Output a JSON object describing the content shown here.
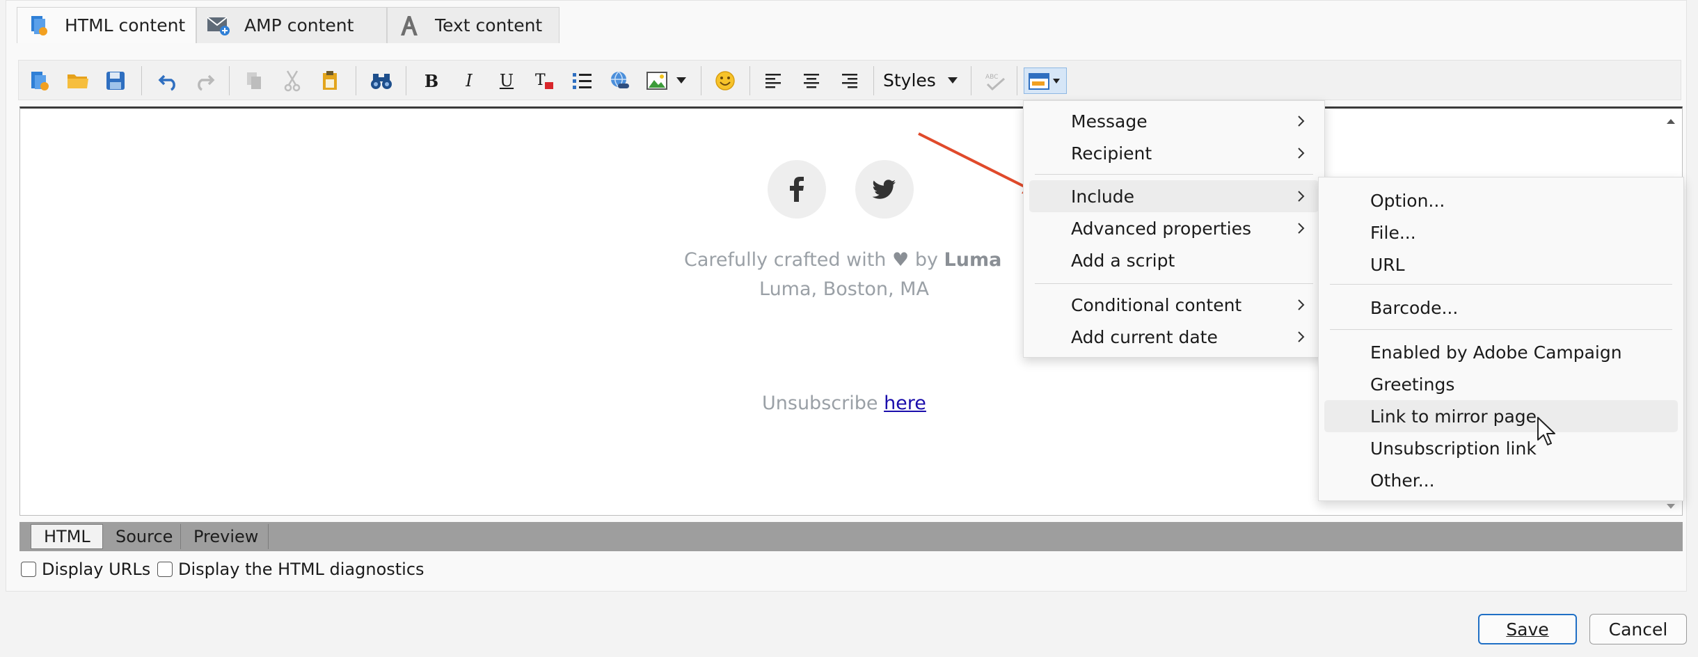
{
  "tabs": [
    {
      "label": "HTML content",
      "icon": "html-content-icon"
    },
    {
      "label": "AMP content",
      "icon": "amp-envelope-icon"
    },
    {
      "label": "Text content",
      "icon": "letter-a-icon"
    }
  ],
  "toolbar": {
    "styles_label": "Styles"
  },
  "editor": {
    "footer_crafted_prefix": "Carefully crafted with",
    "footer_heart": "♥",
    "footer_by": "by",
    "footer_brand": "Luma",
    "footer_address": "Luma, Boston, MA",
    "unsubscribe_prefix": "Unsubscribe",
    "unsubscribe_link": "here"
  },
  "bottom_tabs": [
    "HTML",
    "Source",
    "Preview"
  ],
  "checkboxes": {
    "display_urls": "Display URLs",
    "display_diagnostics": "Display the HTML diagnostics"
  },
  "buttons": {
    "save": "Save",
    "cancel": "Cancel"
  },
  "menu": {
    "items": [
      {
        "label": "Message",
        "submenu": true
      },
      {
        "label": "Recipient",
        "submenu": true
      },
      {
        "label": "Include",
        "submenu": true,
        "highlighted": true
      },
      {
        "label": "Advanced properties",
        "submenu": true
      },
      {
        "label": "Add a script",
        "submenu": false
      },
      {
        "label": "Conditional content",
        "submenu": true
      },
      {
        "label": "Add current date",
        "submenu": true
      }
    ]
  },
  "submenu": {
    "items": [
      {
        "label": "Option..."
      },
      {
        "label": "File..."
      },
      {
        "label": "URL"
      },
      {
        "label": "Barcode..."
      },
      {
        "label": "Enabled by Adobe Campaign"
      },
      {
        "label": "Greetings"
      },
      {
        "label": "Link to mirror page",
        "highlighted": true
      },
      {
        "label": "Unsubscription link"
      },
      {
        "label": "Other..."
      }
    ]
  },
  "colors": {
    "accent_blue": "#1f6fc5",
    "annotation_arrow": "#e04a2b",
    "footer_gray": "#9aa0a6"
  }
}
